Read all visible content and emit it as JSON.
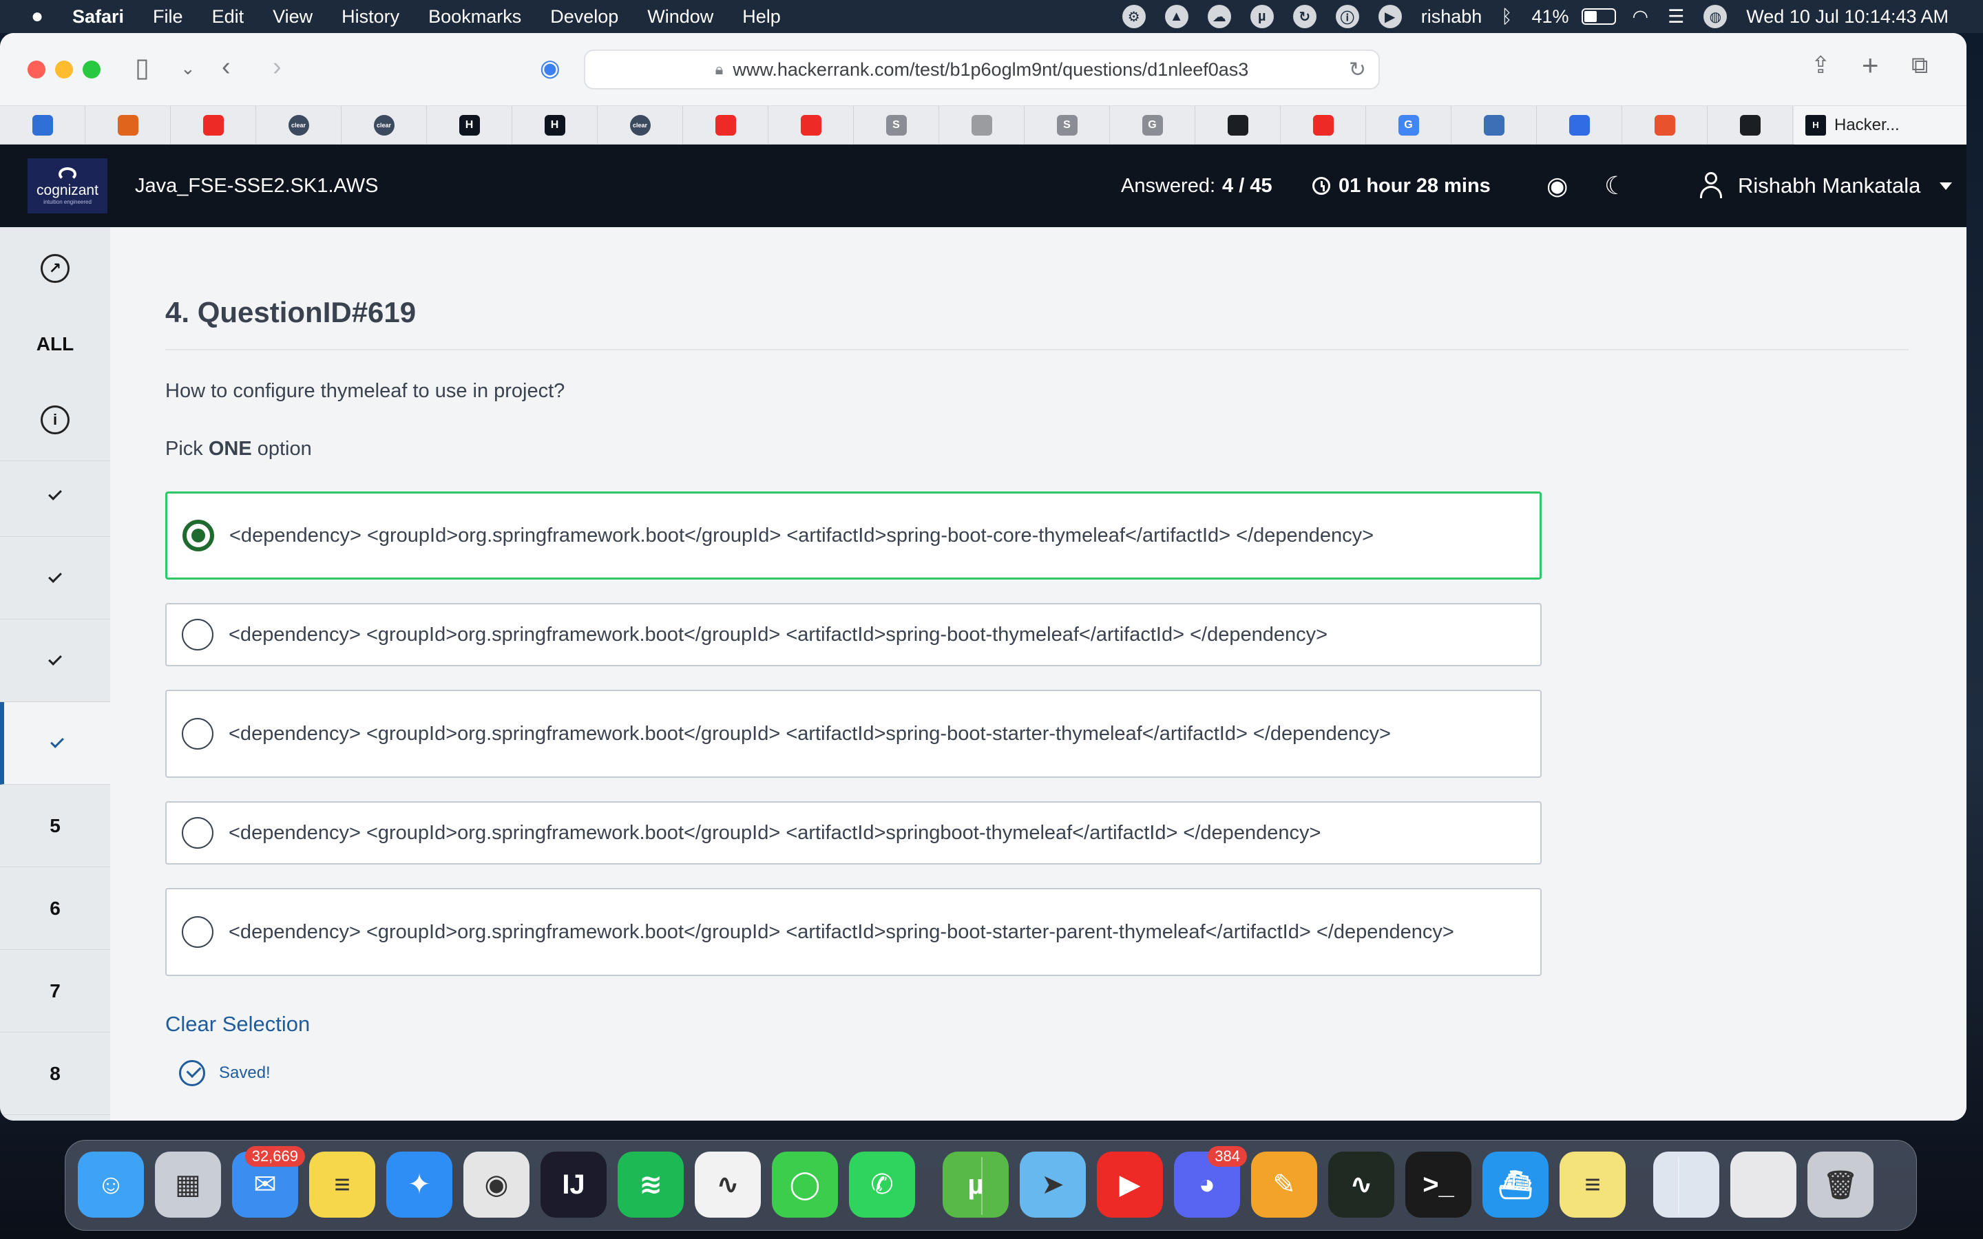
{
  "menubar": {
    "app": "Safari",
    "items": [
      "File",
      "Edit",
      "View",
      "History",
      "Bookmarks",
      "Develop",
      "Window",
      "Help"
    ],
    "user": "rishabh",
    "battery": "41%",
    "battery_level": 0.41,
    "datetime": "Wed 10 Jul  10:14:43 AM"
  },
  "browser": {
    "url": "www.hackerrank.com/test/b1p6oglm9nt/questions/d1nleef0as3",
    "favorites": [
      {
        "icon": "shark-icon",
        "color": "#2f6fd6",
        "text": ""
      },
      {
        "icon": "pencil-icon",
        "color": "#e0641c",
        "text": ""
      },
      {
        "icon": "youtube-icon",
        "color": "#ee2a26",
        "text": ""
      },
      {
        "icon": "clear-icon",
        "color": "#3c4a60",
        "text": "clear"
      },
      {
        "icon": "clear-icon",
        "color": "#3c4a60",
        "text": "clear"
      },
      {
        "icon": "hackerrank-icon",
        "color": "#0e141e",
        "text": "H"
      },
      {
        "icon": "hackerrank-icon",
        "color": "#0e141e",
        "text": "H"
      },
      {
        "icon": "clear-icon",
        "color": "#3c4a60",
        "text": "clear"
      },
      {
        "icon": "youtube-icon",
        "color": "#ee2a26",
        "text": ""
      },
      {
        "icon": "youtube-icon",
        "color": "#ee2a26",
        "text": ""
      },
      {
        "icon": "s-icon",
        "color": "#8a8d93",
        "text": "S"
      },
      {
        "icon": "stamp-icon",
        "color": "#9a9ca0",
        "text": ""
      },
      {
        "icon": "s-icon",
        "color": "#8a8d93",
        "text": "S"
      },
      {
        "icon": "g-icon",
        "color": "#8a8d93",
        "text": "G"
      },
      {
        "icon": "github-icon",
        "color": "#1b1f23",
        "text": ""
      },
      {
        "icon": "youtube-icon",
        "color": "#ee2a26",
        "text": ""
      },
      {
        "icon": "google-icon",
        "color": "#4285f4",
        "text": "G"
      },
      {
        "icon": "shield-icon",
        "color": "#3b6fb6",
        "text": ""
      },
      {
        "icon": "kubernetes-icon",
        "color": "#326ce5",
        "text": ""
      },
      {
        "icon": "stripes-icon",
        "color": "#e8532e",
        "text": ""
      },
      {
        "icon": "github-icon",
        "color": "#1b1f23",
        "text": ""
      }
    ],
    "active_tab": "Hacker..."
  },
  "header": {
    "logo_name": "cognizant",
    "logo_tagline": "intuition engineered",
    "test_title": "Java_FSE-SSE2.SK1.AWS",
    "answered_label": "Answered:",
    "answered_value": "4 / 45",
    "timer": "01 hour 28 mins",
    "user_name": "Rishabh Mankatala"
  },
  "sidebar": {
    "all_label": "ALL",
    "items": [
      {
        "type": "check"
      },
      {
        "type": "check"
      },
      {
        "type": "check"
      },
      {
        "type": "check",
        "active": true
      },
      {
        "type": "number",
        "label": "5"
      },
      {
        "type": "number",
        "label": "6"
      },
      {
        "type": "number",
        "label": "7"
      },
      {
        "type": "number",
        "label": "8"
      }
    ]
  },
  "question": {
    "title": "4. QuestionID#619",
    "text": "How to configure thymeleaf to use in project?",
    "pick_prefix": "Pick ",
    "pick_bold": "ONE",
    "pick_suffix": " option",
    "options": [
      {
        "text": "<dependency> <groupId>org.springframework.boot</groupId> <artifactId>spring-boot-core-thymeleaf</artifactId> </dependency>",
        "selected": true
      },
      {
        "text": "<dependency> <groupId>org.springframework.boot</groupId> <artifactId>spring-boot-thymeleaf</artifactId> </dependency>",
        "selected": false
      },
      {
        "text": "<dependency> <groupId>org.springframework.boot</groupId> <artifactId>spring-boot-starter-thymeleaf</artifactId> </dependency>",
        "selected": false
      },
      {
        "text": "<dependency> <groupId>org.springframework.boot</groupId> <artifactId>springboot-thymeleaf</artifactId> </dependency>",
        "selected": false
      },
      {
        "text": "<dependency> <groupId>org.springframework.boot</groupId> <artifactId>spring-boot-starter-parent-thymeleaf</artifactId> </dependency>",
        "selected": false
      }
    ],
    "clear_label": "Clear Selection",
    "saved_label": "Saved!"
  },
  "dock": {
    "apps": [
      {
        "name": "finder-icon",
        "color": "#3fa3f5",
        "glyph": "☺"
      },
      {
        "name": "launchpad-icon",
        "color": "#c9ced6",
        "glyph": "▦"
      },
      {
        "name": "mail-icon",
        "color": "#3a8ef0",
        "glyph": "✉",
        "badge": "32,669"
      },
      {
        "name": "notes-icon",
        "color": "#f6d64a",
        "glyph": "≡"
      },
      {
        "name": "safari-icon",
        "color": "#2f8ef5",
        "glyph": "✦"
      },
      {
        "name": "chrome-icon",
        "color": "#e5e5e5",
        "glyph": "◉"
      },
      {
        "name": "intellij-icon",
        "color": "#1b1b2b",
        "glyph": "IJ"
      },
      {
        "name": "spotify-icon",
        "color": "#1db954",
        "glyph": "≋"
      },
      {
        "name": "freeform-icon",
        "color": "#f2f2f2",
        "glyph": "∿"
      },
      {
        "name": "messages-icon",
        "color": "#3ccd4c",
        "glyph": "◯"
      },
      {
        "name": "whatsapp-icon",
        "color": "#2fd45d",
        "glyph": "✆"
      },
      {
        "name": "utorrent-icon",
        "color": "#58b947",
        "glyph": "µ"
      },
      {
        "name": "maps-icon",
        "color": "#68b8f0",
        "glyph": "➤"
      },
      {
        "name": "youtube-icon",
        "color": "#ee2a26",
        "glyph": "▶"
      },
      {
        "name": "discord-icon",
        "color": "#5865f2",
        "glyph": "◕",
        "badge": "384"
      },
      {
        "name": "pages-icon",
        "color": "#f2a42a",
        "glyph": "✎"
      },
      {
        "name": "activity-monitor-icon",
        "color": "#1e2a22",
        "glyph": "∿"
      },
      {
        "name": "terminal-icon",
        "color": "#1b1b1b",
        "glyph": ">_"
      },
      {
        "name": "docker-icon",
        "color": "#2496ed",
        "glyph": "⛴"
      },
      {
        "name": "stickies-icon",
        "color": "#f4e27a",
        "glyph": "≡"
      },
      {
        "name": "window-thumbnail-icon",
        "color": "#dfe5ee",
        "glyph": ""
      },
      {
        "name": "window-thumbnail-icon",
        "color": "#e8e8ea",
        "glyph": ""
      },
      {
        "name": "trash-icon",
        "color": "#c8ccd2",
        "glyph": "🗑"
      }
    ]
  }
}
